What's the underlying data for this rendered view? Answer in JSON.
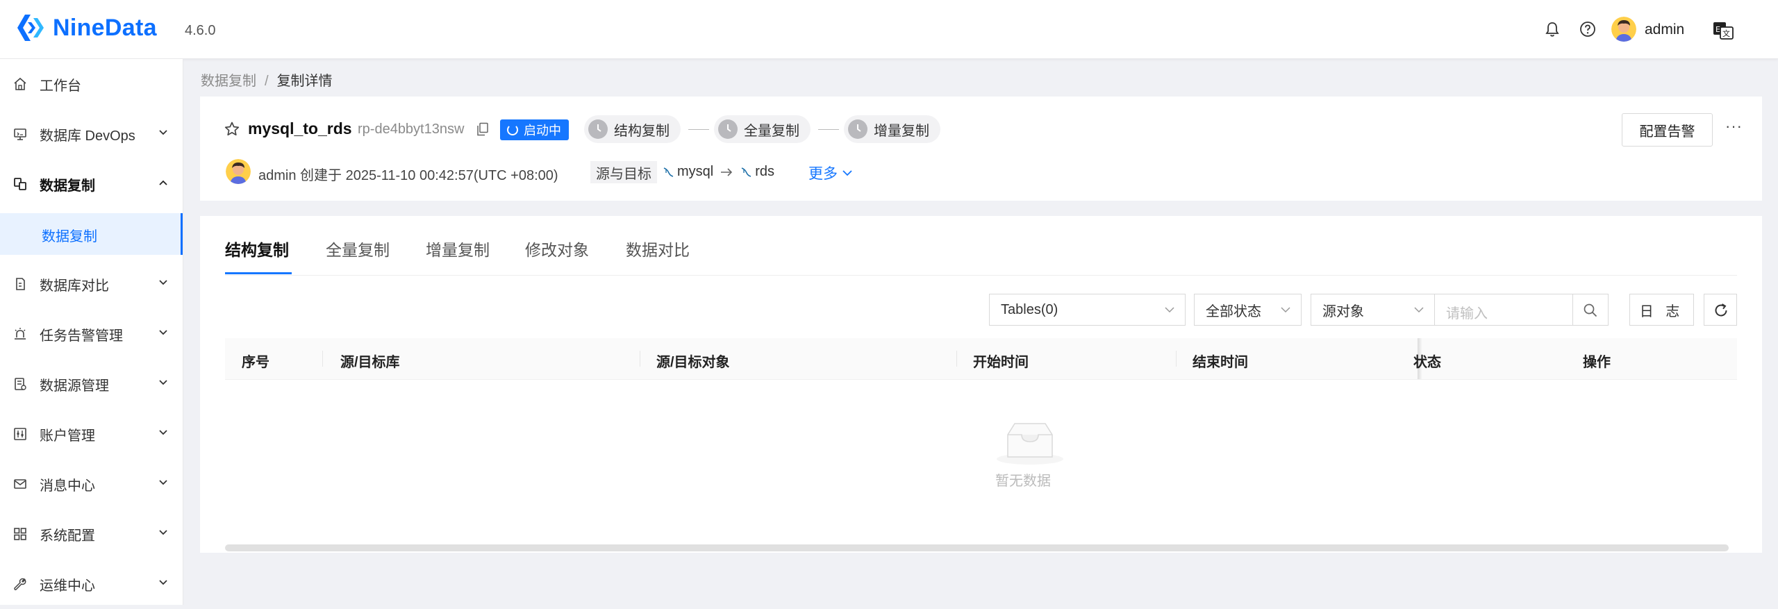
{
  "app": {
    "logo_text": "NineData",
    "version": "4.6.0",
    "user": "admin",
    "brand_color": "#0d70ff"
  },
  "sidebar": {
    "items": [
      {
        "label": "工作台",
        "icon": "home-icon"
      },
      {
        "label": "数据库 DevOps",
        "icon": "devops-icon"
      },
      {
        "label": "数据复制",
        "icon": "replication-icon",
        "expanded": true
      },
      {
        "label": "数据库对比",
        "icon": "compare-icon"
      },
      {
        "label": "任务告警管理",
        "icon": "alarm-icon"
      },
      {
        "label": "数据源管理",
        "icon": "datasource-icon"
      },
      {
        "label": "账户管理",
        "icon": "account-icon"
      },
      {
        "label": "消息中心",
        "icon": "mail-icon"
      },
      {
        "label": "系统配置",
        "icon": "grid-icon"
      },
      {
        "label": "运维中心",
        "icon": "wrench-icon"
      }
    ],
    "sub_item": "数据复制"
  },
  "breadcrumb": {
    "parent": "数据复制",
    "separator": "/",
    "current": "复制详情"
  },
  "task": {
    "name": "mysql_to_rds",
    "id": "rp-de4bbyt13nsw",
    "status": "启动中",
    "steps": [
      "结构复制",
      "全量复制",
      "增量复制"
    ],
    "config_alarm_label": "配置告警",
    "more_dots": "···",
    "creator": "admin",
    "created_text": "创建于 2025-11-10 00:42:57(UTC +08:00)",
    "src_target_label": "源与目标",
    "source_db": "mysql",
    "target_db": "rds",
    "more_label": "更多"
  },
  "tabs": [
    "结构复制",
    "全量复制",
    "增量复制",
    "修改对象",
    "数据对比"
  ],
  "filters": {
    "tables": "Tables(0)",
    "status": "全部状态",
    "object": "源对象",
    "search_placeholder": "请输入",
    "log_label": "日 志"
  },
  "table": {
    "columns": [
      "序号",
      "源/目标库",
      "源/目标对象",
      "开始时间",
      "结束时间",
      "状态",
      "操作"
    ],
    "rows": [],
    "empty_text": "暂无数据"
  }
}
